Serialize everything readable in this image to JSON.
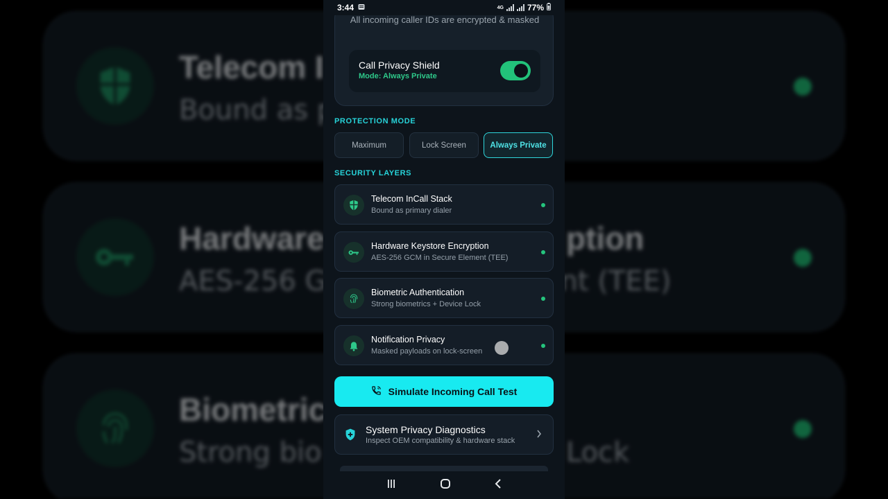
{
  "colors": {
    "accent_cyan": "#27d3d9",
    "accent_green": "#25c47d",
    "card_bg": "#141d27",
    "screen_bg": "#0d141b"
  },
  "status_bar": {
    "time": "3:44",
    "battery": "77%",
    "network": "4G"
  },
  "header_card": {
    "description": "All incoming caller IDs are encrypted & masked",
    "shield": {
      "title": "Call Privacy Shield",
      "mode_text": "Mode: Always Private",
      "enabled": true,
      "icon": "toggle-switch"
    }
  },
  "protection_mode": {
    "label": "PROTECTION MODE",
    "options": [
      "Maximum",
      "Lock Screen",
      "Always Private"
    ],
    "selected": "Always Private"
  },
  "security_layers": {
    "label": "SECURITY LAYERS",
    "items": [
      {
        "title": "Telecom InCall Stack",
        "subtitle": "Bound as primary dialer",
        "icon": "shield-icon",
        "status": "active"
      },
      {
        "title": "Hardware Keystore Encryption",
        "subtitle": "AES-256 GCM in Secure Element (TEE)",
        "icon": "key-icon",
        "status": "active"
      },
      {
        "title": "Biometric Authentication",
        "subtitle": "Strong biometrics + Device Lock",
        "icon": "fingerprint-icon",
        "status": "active"
      },
      {
        "title": "Notification Privacy",
        "subtitle": "Masked payloads on lock-screen",
        "icon": "bell-icon",
        "status": "active"
      }
    ]
  },
  "simulate_button": {
    "label": "Simulate Incoming Call Test",
    "icon": "phone-ringing-icon"
  },
  "diagnostics": {
    "title": "System Privacy Diagnostics",
    "subtitle": "Inspect OEM compatibility & hardware stack",
    "icon": "shield-plus-icon"
  },
  "background_zoom": {
    "rows": [
      {
        "left_title": "Telecom I",
        "left_sub": "Bound as p",
        "right_title": "",
        "right_sub": ""
      },
      {
        "left_title": "Hardware",
        "left_sub": "AES-256 G",
        "right_title": "ption",
        "right_sub": "ment (TEE)"
      },
      {
        "left_title": "Biometric",
        "left_sub": "Strong bio",
        "right_title": "",
        "right_sub": "Lock"
      }
    ]
  }
}
